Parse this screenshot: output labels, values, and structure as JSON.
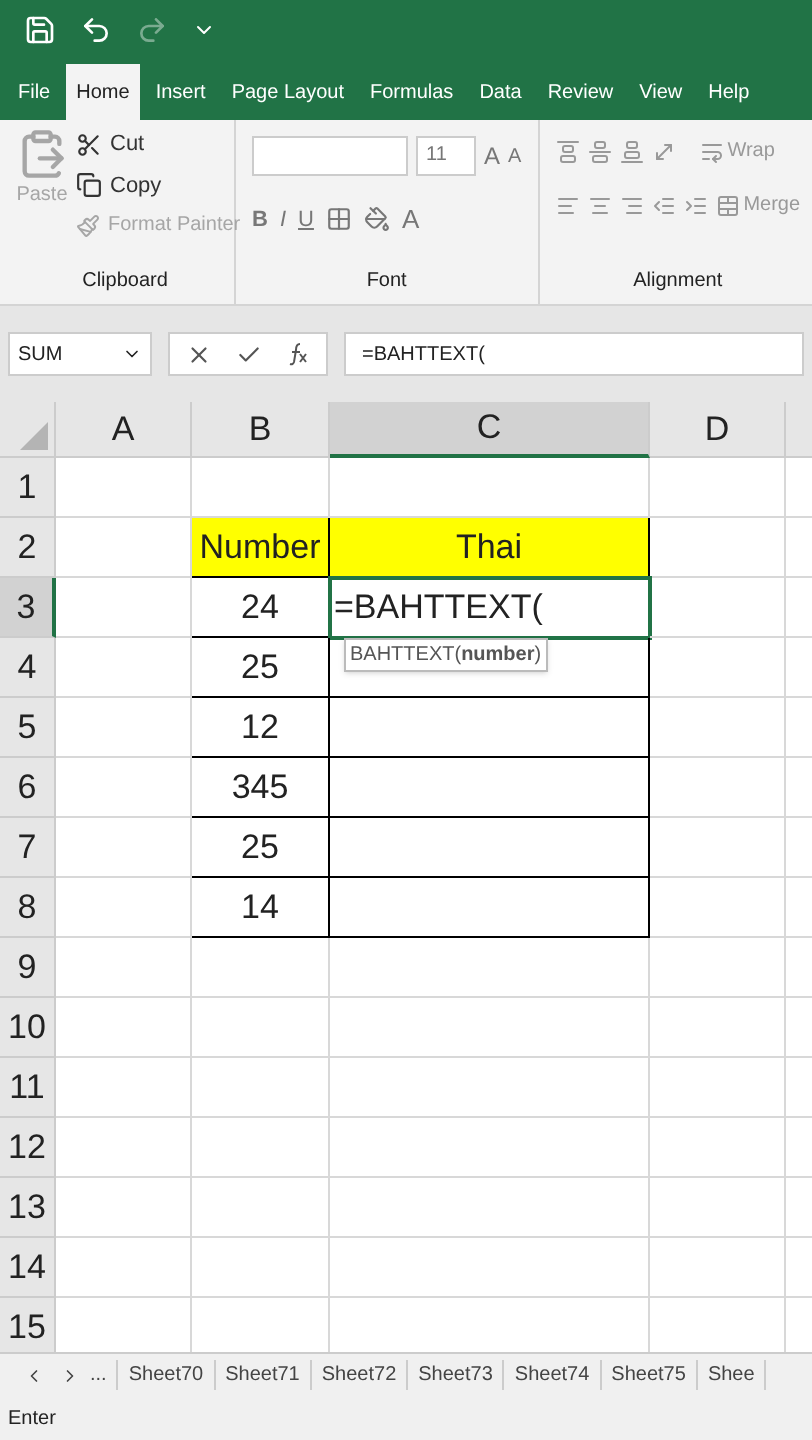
{
  "ribbon_tabs": [
    {
      "label": "File",
      "selected": false
    },
    {
      "label": "Home",
      "selected": true
    },
    {
      "label": "Insert",
      "selected": false
    },
    {
      "label": "Page Layout",
      "selected": false
    },
    {
      "label": "Formulas",
      "selected": false
    },
    {
      "label": "Data",
      "selected": false
    },
    {
      "label": "Review",
      "selected": false
    },
    {
      "label": "View",
      "selected": false
    },
    {
      "label": "Help",
      "selected": false
    }
  ],
  "clipboard": {
    "paste": {
      "label": "Paste",
      "disabled": true
    },
    "cut": {
      "label": "Cut",
      "disabled": false
    },
    "copy": {
      "label": "Copy",
      "disabled": false
    },
    "format_painter": {
      "label": "Format Painter",
      "disabled": true
    },
    "group_label": "Clipboard"
  },
  "font": {
    "size": "11",
    "grow": "A",
    "shrink": "A",
    "bold": "B",
    "italic": "I",
    "underline": "U",
    "font_color": "A",
    "group_label": "Font"
  },
  "alignment": {
    "wrap": "Wrap",
    "merge": "Merge",
    "group_label": "Alignment"
  },
  "name_box": "SUM",
  "formula": "=BAHTTEXT(",
  "columns": [
    {
      "label": "A",
      "selected": false
    },
    {
      "label": "B",
      "selected": false
    },
    {
      "label": "C",
      "selected": true
    },
    {
      "label": "D",
      "selected": false
    }
  ],
  "rows": [
    {
      "label": "1",
      "selected": false
    },
    {
      "label": "2",
      "selected": false,
      "cells": [
        {},
        {
          "text": "Number",
          "highlighted": true,
          "bordered": true
        },
        {
          "text": "Thai",
          "highlighted": true,
          "bordered": true
        }
      ]
    },
    {
      "label": "3",
      "selected": true,
      "cells": [
        {},
        {
          "text": "24",
          "bordered": true
        },
        {
          "text": "=BAHTTEXT(",
          "bordered": true,
          "active": true
        }
      ]
    },
    {
      "label": "4",
      "selected": false,
      "cells": [
        {},
        {
          "text": "25",
          "bordered": true
        },
        {
          "bordered": true
        }
      ]
    },
    {
      "label": "5",
      "selected": false,
      "cells": [
        {},
        {
          "text": "12",
          "bordered": true
        },
        {
          "bordered": true
        }
      ]
    },
    {
      "label": "6",
      "selected": false,
      "cells": [
        {},
        {
          "text": "345",
          "bordered": true
        },
        {
          "bordered": true
        }
      ]
    },
    {
      "label": "7",
      "selected": false,
      "cells": [
        {},
        {
          "text": "25",
          "bordered": true
        },
        {
          "bordered": true
        }
      ]
    },
    {
      "label": "8",
      "selected": false,
      "cells": [
        {},
        {
          "text": "14",
          "bordered": true
        },
        {
          "bordered": true
        }
      ]
    },
    {
      "label": "9",
      "selected": false
    },
    {
      "label": "10",
      "selected": false
    },
    {
      "label": "11",
      "selected": false
    },
    {
      "label": "12",
      "selected": false
    },
    {
      "label": "13",
      "selected": false
    },
    {
      "label": "14",
      "selected": false
    },
    {
      "label": "15",
      "selected": false
    }
  ],
  "tooltip": "BAHTTEXT(**number**)",
  "sheet_tabs": [
    "...",
    "Sheet70",
    "Sheet71",
    "Sheet72",
    "Sheet73",
    "Sheet74",
    "Sheet75",
    "Shee"
  ],
  "status": "Enter"
}
